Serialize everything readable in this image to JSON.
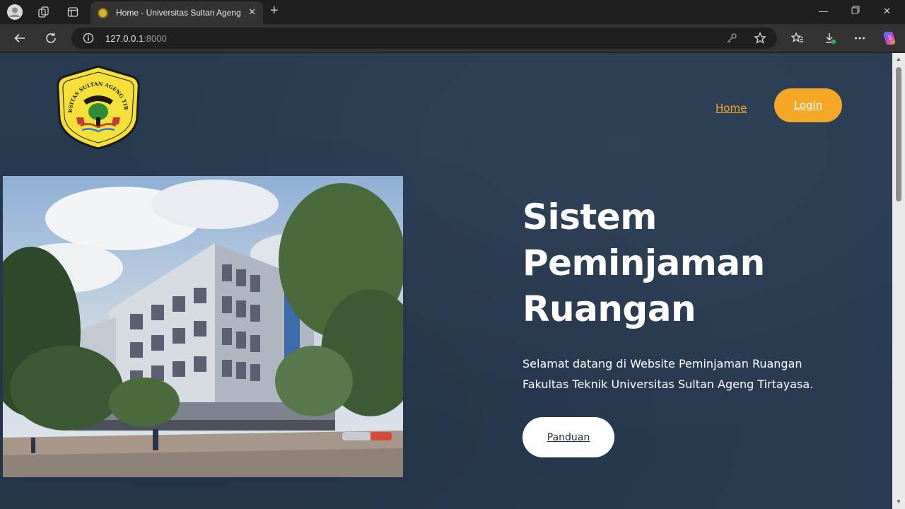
{
  "browser": {
    "tab_title": "Home - Universitas Sultan Ageng Tirtayasa",
    "url_host": "127.0.0.1",
    "url_port": ":8000",
    "icons": [
      "profile-icon",
      "workspaces-icon",
      "tab-actions-icon",
      "new-tab-icon",
      "minimize-icon",
      "restore-icon",
      "close-icon",
      "back-icon",
      "refresh-icon",
      "site-info-icon",
      "password-key-icon",
      "favorite-star-icon",
      "favorites-icon",
      "downloads-icon",
      "more-icon",
      "copilot-icon"
    ]
  },
  "nav": {
    "home_label": "Home",
    "login_label": "Login"
  },
  "logo": {
    "ring_text": "UNIVERSITAS SULTAN AGENG TIRTAYASA",
    "colors": {
      "fill": "#f5e03a",
      "border": "#1a1a1a",
      "emblem": "#2f8a3a"
    }
  },
  "hero": {
    "title_lines": [
      "Sistem",
      "Peminjaman",
      "Ruangan"
    ],
    "description": "Selamat datang di Website Peminjaman Ruangan Fakultas Teknik Universitas Sultan Ageng Tirtayasa.",
    "button_label": "Panduan"
  },
  "colors": {
    "page_background": "#273a50",
    "accent": "#f4a825",
    "button_white": "#ffffff"
  }
}
